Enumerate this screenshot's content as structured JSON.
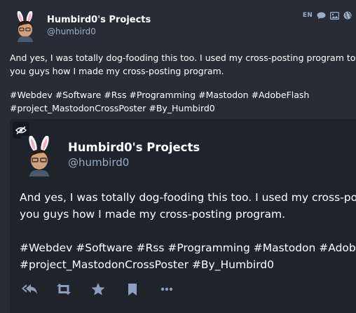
{
  "post": {
    "author_name": "Humbird0's Projects",
    "author_handle": "@humbird0",
    "language": "EN",
    "body_lines": [
      "And yes, I was totally dog-fooding this too. I used my cross-posting program to tell",
      "you guys how I made my cross-posting program."
    ],
    "hashtag_lines": [
      "#Webdev #Software #Rss #Programming #Mastodon #AdobeFlash",
      "#project_MastodonCrossPoster #By_Humbird0"
    ]
  },
  "embed": {
    "author_name": "Humbird0's Projects",
    "author_handle": "@humbird0",
    "body_lines": [
      "And yes, I was totally dog-fooding this too. I used my cross-posting program to tell",
      "you guys how I made my cross-posting program."
    ],
    "hashtag_lines": [
      "#Webdev #Software #Rss #Programming #Mastodon #AdobeFlash",
      "#project_MastodonCrossPoster #By_Humbird0"
    ]
  },
  "icons": {
    "meta": [
      "speech-bubble-icon",
      "image-icon",
      "globe-icon"
    ],
    "sensitive_toggle": "eye-slash-icon",
    "actions": [
      "reply-all-icon",
      "boost-icon",
      "star-icon",
      "bookmark-icon",
      "more-icon"
    ]
  },
  "colors": {
    "background": "#282c37",
    "embed_background": "#1f232b",
    "secondary_text": "#9baec8",
    "action_icon": "#8c9fbd"
  }
}
